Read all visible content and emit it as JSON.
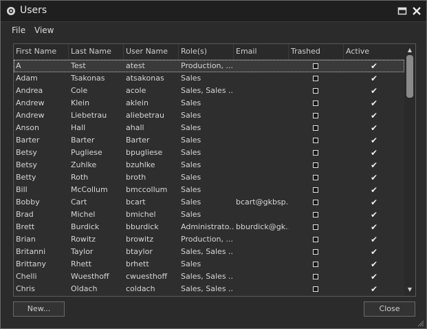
{
  "window": {
    "title": "Users"
  },
  "menu": {
    "items": [
      "File",
      "View"
    ]
  },
  "table": {
    "headers": [
      "First Name",
      "Last Name",
      "User Name",
      "Role(s)",
      "Email",
      "Trashed",
      "Active"
    ],
    "rows": [
      {
        "first": "A",
        "last": "Test",
        "user": "atest",
        "roles": "Production, ...",
        "email": "",
        "active": true,
        "selected": true
      },
      {
        "first": "Adam",
        "last": "Tsakonas",
        "user": "atsakonas",
        "roles": "Sales",
        "email": "",
        "active": true
      },
      {
        "first": "Andrea",
        "last": "Cole",
        "user": "acole",
        "roles": "Sales, Sales ...",
        "email": "",
        "active": true
      },
      {
        "first": "Andrew",
        "last": "Klein",
        "user": "aklein",
        "roles": "Sales",
        "email": "",
        "active": true
      },
      {
        "first": "Andrew",
        "last": "Liebetrau",
        "user": "aliebetrau",
        "roles": "Sales",
        "email": "",
        "active": true
      },
      {
        "first": "Anson",
        "last": "Hall",
        "user": "ahall",
        "roles": "Sales",
        "email": "",
        "active": true
      },
      {
        "first": "Barter",
        "last": "Barter",
        "user": "Barter",
        "roles": "Sales",
        "email": "",
        "active": true
      },
      {
        "first": "Betsy",
        "last": "Pugliese",
        "user": "bpugliese",
        "roles": "Sales",
        "email": "",
        "active": true
      },
      {
        "first": "Betsy",
        "last": "Zuhlke",
        "user": "bzuhlke",
        "roles": "Sales",
        "email": "",
        "active": true
      },
      {
        "first": "Betty",
        "last": "Roth",
        "user": "broth",
        "roles": "Sales",
        "email": "",
        "active": true
      },
      {
        "first": "Bill",
        "last": "McCollum",
        "user": "bmccollum",
        "roles": "Sales",
        "email": "",
        "active": true
      },
      {
        "first": "Bobby",
        "last": "Cart",
        "user": "bcart",
        "roles": "Sales",
        "email": "bcart@gkbsp...",
        "active": true
      },
      {
        "first": "Brad",
        "last": "Michel",
        "user": "bmichel",
        "roles": "Sales",
        "email": "",
        "active": true
      },
      {
        "first": "Brett",
        "last": "Burdick",
        "user": "bburdick",
        "roles": "Administrato...",
        "email": "bburdick@gk...",
        "active": true
      },
      {
        "first": "Brian",
        "last": "Rowitz",
        "user": "browitz",
        "roles": "Production, ...",
        "email": "",
        "active": true
      },
      {
        "first": "Britanni",
        "last": "Taylor",
        "user": "btaylor",
        "roles": "Sales, Sales ...",
        "email": "",
        "active": true
      },
      {
        "first": "Brittany",
        "last": "Rhett",
        "user": "brhett",
        "roles": "Sales",
        "email": "",
        "active": true
      },
      {
        "first": "Chelli",
        "last": "Wuesthoff",
        "user": "cwuesthoff",
        "roles": "Sales, Sales ...",
        "email": "",
        "active": true
      },
      {
        "first": "Chris",
        "last": "Oldach",
        "user": "coldach",
        "roles": "Sales, Sales ...",
        "email": "",
        "active": true
      }
    ]
  },
  "buttons": {
    "new": "New...",
    "close": "Close"
  }
}
